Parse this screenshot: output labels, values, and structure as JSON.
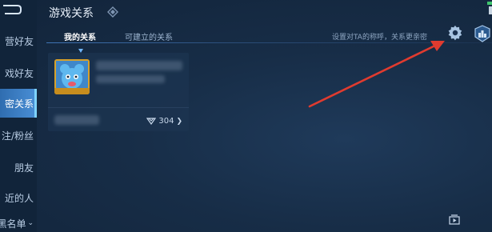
{
  "header": {
    "title": "游戏关系"
  },
  "sidebar": {
    "items": [
      {
        "label": "营好友"
      },
      {
        "label": "戏好友"
      },
      {
        "label": "密关系"
      },
      {
        "label": "注/粉丝"
      },
      {
        "label": "朋友"
      },
      {
        "label": "近的人"
      },
      {
        "label": "黑名单"
      }
    ]
  },
  "tabs": [
    {
      "label": "我的关系"
    },
    {
      "label": "可建立的关系"
    }
  ],
  "hint": "设置对TA的称呼，关系更亲密",
  "card": {
    "intimacy_value": "304"
  },
  "colors": {
    "accent": "#4a8fd6",
    "annotation": "#e03b2f"
  }
}
